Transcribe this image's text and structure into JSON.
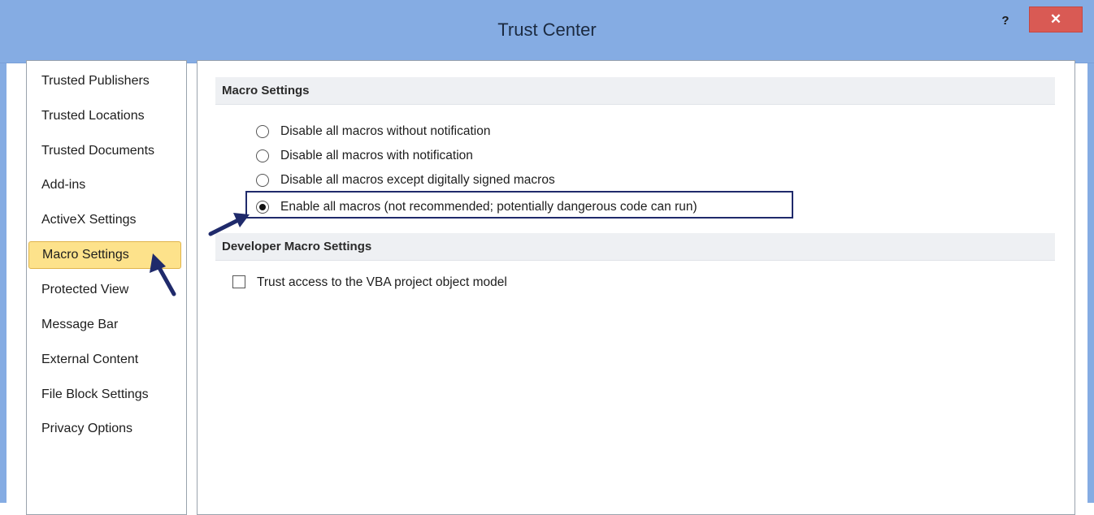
{
  "window": {
    "title": "Trust Center",
    "help_label": "?",
    "close_label": "✕"
  },
  "sidebar": {
    "items": [
      {
        "label": "Trusted Publishers"
      },
      {
        "label": "Trusted Locations"
      },
      {
        "label": "Trusted Documents"
      },
      {
        "label": "Add-ins"
      },
      {
        "label": "ActiveX Settings"
      },
      {
        "label": "Macro Settings",
        "selected": true
      },
      {
        "label": "Protected View"
      },
      {
        "label": "Message Bar"
      },
      {
        "label": "External Content"
      },
      {
        "label": "File Block Settings"
      },
      {
        "label": "Privacy Options"
      }
    ]
  },
  "macro_settings": {
    "header": "Macro Settings",
    "options": [
      {
        "label": "Disable all macros without notification",
        "checked": false
      },
      {
        "label": "Disable all macros with notification",
        "checked": false
      },
      {
        "label": "Disable all macros except digitally signed macros",
        "checked": false
      },
      {
        "label": "Enable all macros (not recommended; potentially dangerous code can run)",
        "checked": true
      }
    ]
  },
  "developer_settings": {
    "header": "Developer Macro Settings",
    "vba_access_label": "Trust access to the VBA project object model",
    "vba_access_checked": false
  },
  "colors": {
    "titlebar": "#85ace3",
    "close_button": "#d95a54",
    "selected_item": "#fde28b",
    "annotation_arrow": "#1f2a6b"
  }
}
